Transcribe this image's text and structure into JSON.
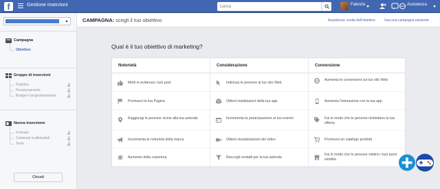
{
  "topbar": {
    "app_title": "Gestione inserzioni",
    "search_placeholder": "Cerca",
    "user_name": "Fabrizio",
    "help_label": "Assistenza"
  },
  "sidebar": {
    "sections": [
      {
        "title": "Campagna",
        "icon": "campaign-icon",
        "items": [
          {
            "label": "Obiettivo",
            "active": true,
            "locked": false
          }
        ]
      },
      {
        "title": "Gruppo di inserzioni",
        "icon": "ad-set-icon",
        "items": [
          {
            "label": "Pubblico",
            "active": false,
            "locked": true
          },
          {
            "label": "Posizionamento",
            "active": false,
            "locked": true
          },
          {
            "label": "Budget e programmazione",
            "active": false,
            "locked": true
          }
        ]
      },
      {
        "title": "Nuova inserzione",
        "icon": "ad-icon",
        "items": [
          {
            "label": "Formato",
            "active": false,
            "locked": true
          },
          {
            "label": "Contenuti multimediali",
            "active": false,
            "locked": true
          },
          {
            "label": "Testo",
            "active": false,
            "locked": true
          }
        ]
      }
    ],
    "close_label": "Chiudi"
  },
  "header": {
    "title_bold": "CAMPAGNA:",
    "title_rest": " scegli il tuo obiettivo",
    "help_link": "Assistenza: scelta dell'obiettivo",
    "existing_link": "Usa una campagna esistente"
  },
  "main": {
    "question": "Qual è il tuo obiettivo di marketing?",
    "columns": [
      {
        "title": "Notorietà",
        "options": [
          {
            "label": "Metti in evidenza i tuoi post",
            "icon": "thumbs-up-icon"
          },
          {
            "label": "Promuovi la tua Pagina",
            "icon": "flag-icon"
          },
          {
            "label": "Raggiungi le persone vicine alla tua azienda",
            "icon": "location-pin-icon"
          },
          {
            "label": "Incrementa la notorietà della marca",
            "icon": "megaphone-icon"
          },
          {
            "label": "Aumento della copertura",
            "icon": "asterisk-icon"
          }
        ]
      },
      {
        "title": "Considerazione",
        "options": [
          {
            "label": "Indirizza le persone al tuo sito Web",
            "icon": "cursor-icon"
          },
          {
            "label": "Ottieni installazioni della tua app",
            "icon": "box-icon"
          },
          {
            "label": "Incrementa la partecipazione al tuo evento",
            "icon": "calendar-icon"
          },
          {
            "label": "Ottieni visualizzazioni del video",
            "icon": "video-camera-icon"
          },
          {
            "label": "Raccogli contatti per la tua azienda",
            "icon": "filter-icon"
          }
        ]
      },
      {
        "title": "Conversione",
        "options": [
          {
            "label": "Aumenta le conversioni sul tuo sito Web",
            "icon": "globe-icon"
          },
          {
            "label": "Aumenta l'interazione con la tua app",
            "icon": "mobile-phone-icon"
          },
          {
            "label": "Fai in modo che le persone richiedano la tua offerta",
            "icon": "tag-icon"
          },
          {
            "label": "Promuovi un catalogo prodotti",
            "icon": "cart-icon"
          },
          {
            "label": "Fai in modo che le persone visitino i tuoi punti vendita",
            "icon": "store-icon"
          }
        ]
      }
    ]
  },
  "colors": {
    "brand_blue": "#4267b2",
    "page_bg": "#e9ebee",
    "icon_grey": "#90949c"
  }
}
